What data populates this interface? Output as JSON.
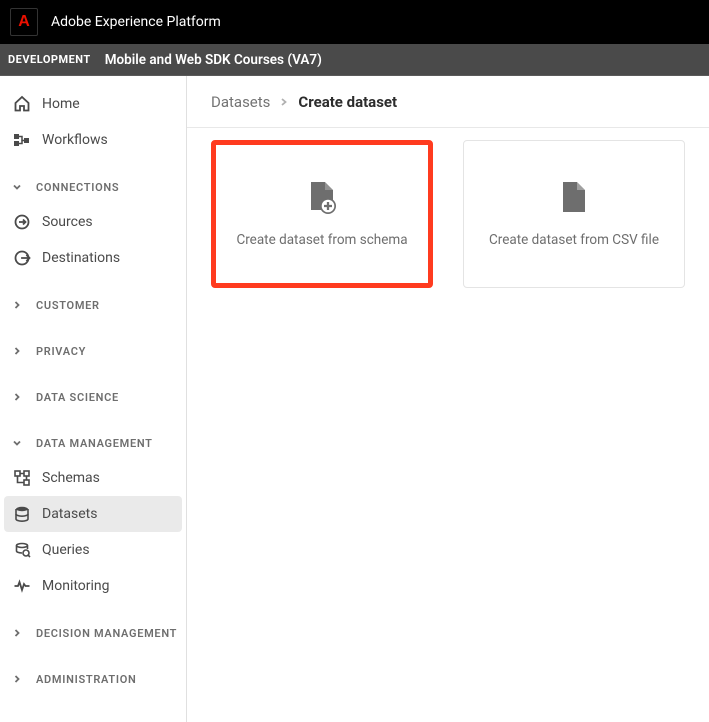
{
  "header": {
    "app_title": "Adobe Experience Platform"
  },
  "env": {
    "label": "DEVELOPMENT",
    "project": "Mobile and Web SDK Courses (VA7)"
  },
  "sidebar": {
    "top_items": [
      {
        "name": "home",
        "label": "Home"
      },
      {
        "name": "workflows",
        "label": "Workflows"
      }
    ],
    "groups": [
      {
        "name": "connections",
        "label": "CONNECTIONS",
        "expanded": true,
        "items": [
          {
            "name": "sources",
            "label": "Sources"
          },
          {
            "name": "destinations",
            "label": "Destinations"
          }
        ]
      },
      {
        "name": "customer",
        "label": "CUSTOMER",
        "expanded": false
      },
      {
        "name": "privacy",
        "label": "PRIVACY",
        "expanded": false
      },
      {
        "name": "data-science",
        "label": "DATA SCIENCE",
        "expanded": false
      },
      {
        "name": "data-management",
        "label": "DATA MANAGEMENT",
        "expanded": true,
        "items": [
          {
            "name": "schemas",
            "label": "Schemas",
            "active": false
          },
          {
            "name": "datasets",
            "label": "Datasets",
            "active": true
          },
          {
            "name": "queries",
            "label": "Queries",
            "active": false
          },
          {
            "name": "monitoring",
            "label": "Monitoring",
            "active": false
          }
        ]
      },
      {
        "name": "decision-management",
        "label": "DECISION MANAGEMENT",
        "expanded": false
      },
      {
        "name": "administration",
        "label": "ADMINISTRATION",
        "expanded": false
      }
    ]
  },
  "breadcrumb": {
    "parent": "Datasets",
    "current": "Create dataset"
  },
  "cards": [
    {
      "name": "from-schema",
      "label": "Create dataset from schema",
      "highlighted": true
    },
    {
      "name": "from-csv",
      "label": "Create dataset from CSV file",
      "highlighted": false
    }
  ]
}
